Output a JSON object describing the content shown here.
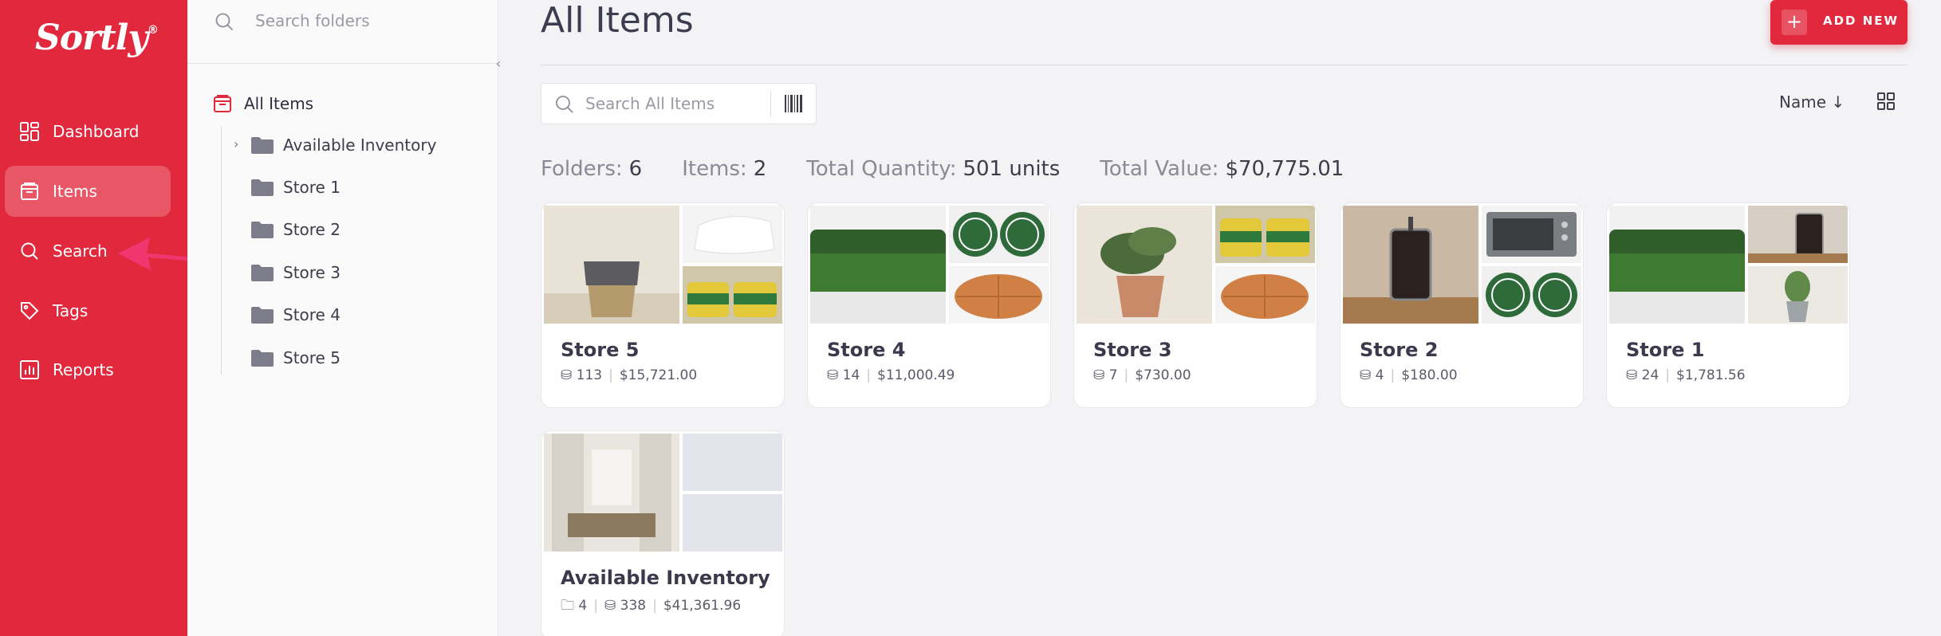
{
  "brand": {
    "logo": "Sortly",
    "reg": "®"
  },
  "nav": {
    "items": [
      {
        "label": "Dashboard",
        "icon": "dashboard-icon"
      },
      {
        "label": "Items",
        "icon": "items-icon",
        "active": true
      },
      {
        "label": "Search",
        "icon": "search-icon"
      },
      {
        "label": "Tags",
        "icon": "tag-icon"
      },
      {
        "label": "Reports",
        "icon": "reports-icon"
      }
    ]
  },
  "folders": {
    "search_placeholder": "Search folders",
    "root": "All Items",
    "items": [
      "Available Inventory",
      "Store 1",
      "Store 2",
      "Store 3",
      "Store 4",
      "Store 5"
    ]
  },
  "main": {
    "title": "All Items",
    "add_button": "ADD NEW",
    "search_placeholder": "Search All Items",
    "sort_label": "Name",
    "summary": {
      "folders_label": "Folders:",
      "folders_value": "6",
      "items_label": "Items:",
      "items_value": "2",
      "qty_label": "Total Quantity:",
      "qty_value": "501 units",
      "value_label": "Total Value:",
      "value_value": "$70,775.01"
    },
    "cards": [
      {
        "name": "Store 5",
        "qty": "113",
        "value": "$15,721.00"
      },
      {
        "name": "Store 4",
        "qty": "14",
        "value": "$11,000.49"
      },
      {
        "name": "Store 3",
        "qty": "7",
        "value": "$730.00"
      },
      {
        "name": "Store 2",
        "qty": "4",
        "value": "$180.00"
      },
      {
        "name": "Store 1",
        "qty": "24",
        "value": "$1,781.56"
      },
      {
        "name": "Available Inventory",
        "folders": "4",
        "qty": "338",
        "value": "$41,361.96"
      }
    ]
  },
  "colors": {
    "brand_red": "#e2283c",
    "background": "#f3f3f5"
  }
}
